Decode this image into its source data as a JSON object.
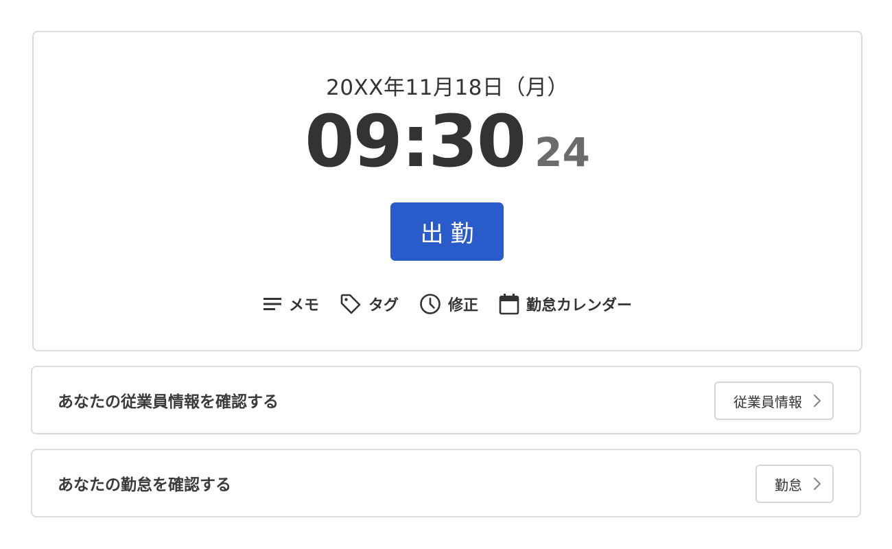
{
  "clock": {
    "date": "20XX年11月18日（月）",
    "time": "09:30",
    "seconds": "24",
    "clock_in_label": "出勤"
  },
  "actions": [
    {
      "label": "メモ",
      "icon": "memo-lines-icon"
    },
    {
      "label": "タグ",
      "icon": "tag-icon"
    },
    {
      "label": "修正",
      "icon": "clock-icon"
    },
    {
      "label": "勤怠カレンダー",
      "icon": "calendar-icon"
    }
  ],
  "links": [
    {
      "text": "あなたの従業員情報を確認する",
      "button": "従業員情報",
      "icon": "chevron-right-icon"
    },
    {
      "text": "あなたの勤怠を確認する",
      "button": "勤怠",
      "icon": "chevron-right-icon"
    }
  ],
  "colors": {
    "primary": "#2a5bca",
    "text": "#333333",
    "muted": "#6b6b6b",
    "border": "#dcdcdc"
  }
}
